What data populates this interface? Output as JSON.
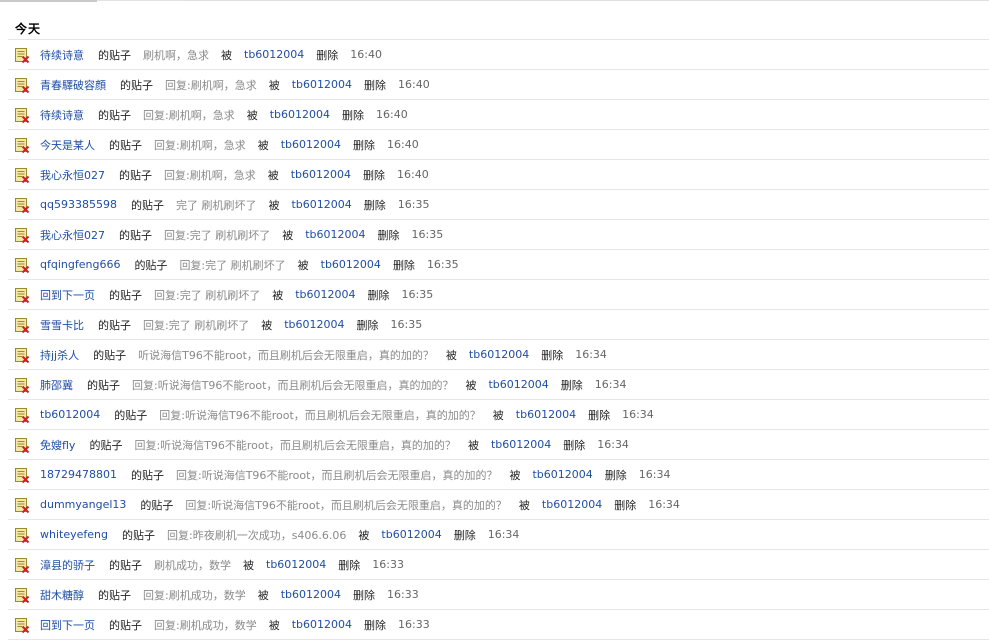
{
  "header": {
    "section": "今天"
  },
  "labels": {
    "post_of": "的贴子",
    "by": "被",
    "action": "删除"
  },
  "colors": {
    "link": "#1f4ea3",
    "muted": "#8a8a8a",
    "divider": "#e6e6e6"
  },
  "icon": "deleted-post-icon",
  "rows": [
    {
      "user": "待续诗意",
      "title": "刷机啊，急求",
      "operator": "tb6012004",
      "time": "16:40"
    },
    {
      "user": "青春驛破容顔",
      "title": "回复:刷机啊，急求",
      "operator": "tb6012004",
      "time": "16:40"
    },
    {
      "user": "待续诗意",
      "title": "回复:刷机啊，急求",
      "operator": "tb6012004",
      "time": "16:40"
    },
    {
      "user": "今天是某人",
      "title": "回复:刷机啊，急求",
      "operator": "tb6012004",
      "time": "16:40"
    },
    {
      "user": "我心永恒027",
      "title": "回复:刷机啊，急求",
      "operator": "tb6012004",
      "time": "16:40"
    },
    {
      "user": "qq593385598",
      "title": "完了 刷机刷坏了",
      "operator": "tb6012004",
      "time": "16:35"
    },
    {
      "user": "我心永恒027",
      "title": "回复:完了 刷机刷坏了",
      "operator": "tb6012004",
      "time": "16:35"
    },
    {
      "user": "qfqingfeng666",
      "title": "回复:完了 刷机刷坏了",
      "operator": "tb6012004",
      "time": "16:35"
    },
    {
      "user": "回到下一页",
      "title": "回复:完了 刷机刷坏了",
      "operator": "tb6012004",
      "time": "16:35"
    },
    {
      "user": "雪雪卡比",
      "title": "回复:完了 刷机刷坏了",
      "operator": "tb6012004",
      "time": "16:35"
    },
    {
      "user": "持jj杀人",
      "title": "听说海信T96不能root，而且刷机后会无限重启，真的加的？",
      "operator": "tb6012004",
      "time": "16:34"
    },
    {
      "user": "肺邵冀",
      "title": "回复:听说海信T96不能root，而且刷机后会无限重启，真的加的？",
      "operator": "tb6012004",
      "time": "16:34"
    },
    {
      "user": "tb6012004",
      "title": "回复:听说海信T96不能root，而且刷机后会无限重启，真的加的？",
      "operator": "tb6012004",
      "time": "16:34"
    },
    {
      "user": "免嫂fly",
      "title": "回复:听说海信T96不能root，而且刷机后会无限重启，真的加的？",
      "operator": "tb6012004",
      "time": "16:34"
    },
    {
      "user": "18729478801",
      "title": "回复:听说海信T96不能root，而且刷机后会无限重启，真的加的？",
      "operator": "tb6012004",
      "time": "16:34"
    },
    {
      "user": "dummyangel13",
      "title": "回复:听说海信T96不能root，而且刷机后会无限重启，真的加的？",
      "operator": "tb6012004",
      "time": "16:34"
    },
    {
      "user": "whiteyefeng",
      "title": "回复:昨夜刷机一次成功，s406.6.06",
      "operator": "tb6012004",
      "time": "16:34"
    },
    {
      "user": "漳县的骄子",
      "title": "刷机成功，数学",
      "operator": "tb6012004",
      "time": "16:33"
    },
    {
      "user": "甜木糖醇",
      "title": "回复:刷机成功，数学",
      "operator": "tb6012004",
      "time": "16:33"
    },
    {
      "user": "回到下一页",
      "title": "回复:刷机成功，数学",
      "operator": "tb6012004",
      "time": "16:33"
    }
  ]
}
